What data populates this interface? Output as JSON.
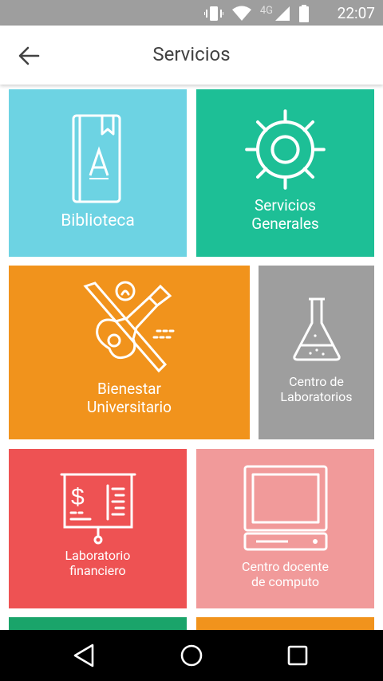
{
  "status_bar": {
    "time": "22:07",
    "network": "4G"
  },
  "app_bar": {
    "title": "Servicios"
  },
  "tiles": [
    {
      "label_line1": "Biblioteca",
      "color": "#6dd3e3"
    },
    {
      "label_line1": "Servicios",
      "label_line2": "Generales",
      "color": "#1dbf96"
    },
    {
      "label_line1": "Bienestar",
      "label_line2": "Universitario",
      "color": "#f1931c"
    },
    {
      "label_line1": "Centro de",
      "label_line2": "Laboratorios",
      "color": "#9e9e9e"
    },
    {
      "label_line1": "Laboratorio",
      "label_line2": "financiero",
      "color": "#ee5253"
    },
    {
      "label_line1": "Centro docente",
      "label_line2": "de computo",
      "color": "#f19a9a"
    },
    {
      "color": "#1aa46a"
    },
    {
      "color": "#f1931c"
    }
  ]
}
